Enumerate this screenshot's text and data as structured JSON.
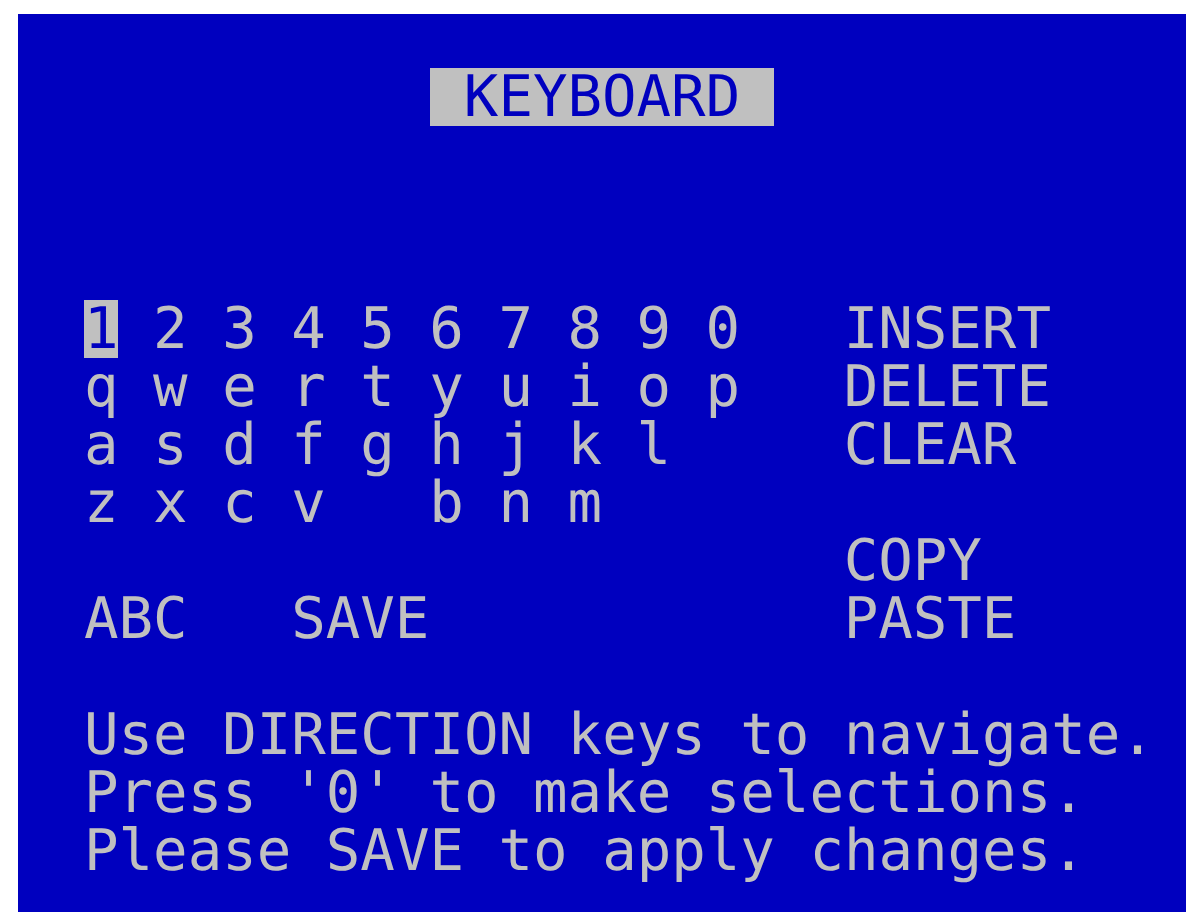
{
  "title": "KEYBOARD",
  "keys": [
    [
      {
        "label": "1",
        "selected": true
      },
      {
        "label": "2",
        "selected": false
      },
      {
        "label": "3",
        "selected": false
      },
      {
        "label": "4",
        "selected": false
      },
      {
        "label": "5",
        "selected": false
      },
      {
        "label": "6",
        "selected": false
      },
      {
        "label": "7",
        "selected": false
      },
      {
        "label": "8",
        "selected": false
      },
      {
        "label": "9",
        "selected": false
      },
      {
        "label": "0",
        "selected": false
      }
    ],
    [
      {
        "label": "q",
        "selected": false
      },
      {
        "label": "w",
        "selected": false
      },
      {
        "label": "e",
        "selected": false
      },
      {
        "label": "r",
        "selected": false
      },
      {
        "label": "t",
        "selected": false
      },
      {
        "label": "y",
        "selected": false
      },
      {
        "label": "u",
        "selected": false
      },
      {
        "label": "i",
        "selected": false
      },
      {
        "label": "o",
        "selected": false
      },
      {
        "label": "p",
        "selected": false
      }
    ],
    [
      {
        "label": "a",
        "selected": false
      },
      {
        "label": "s",
        "selected": false
      },
      {
        "label": "d",
        "selected": false
      },
      {
        "label": "f",
        "selected": false
      },
      {
        "label": "g",
        "selected": false
      },
      {
        "label": "h",
        "selected": false
      },
      {
        "label": "j",
        "selected": false
      },
      {
        "label": "k",
        "selected": false
      },
      {
        "label": "l",
        "selected": false
      }
    ],
    [
      {
        "label": "z",
        "selected": false
      },
      {
        "label": "x",
        "selected": false
      },
      {
        "label": "c",
        "selected": false
      },
      {
        "label": "v",
        "selected": false
      },
      {
        "label": "b",
        "selected": false
      },
      {
        "label": "n",
        "selected": false
      },
      {
        "label": "m",
        "selected": false
      }
    ]
  ],
  "side_actions": [
    {
      "label": "INSERT",
      "selected": false
    },
    {
      "label": "DELETE",
      "selected": false
    },
    {
      "label": "CLEAR",
      "selected": false
    },
    {
      "label": "COPY",
      "selected": false
    },
    {
      "label": "PASTE",
      "selected": false
    }
  ],
  "bottom_actions": [
    {
      "label": "ABC",
      "selected": false
    },
    {
      "label": "SAVE",
      "selected": false
    }
  ],
  "help": [
    "Use DIRECTION keys to navigate.",
    "Press '0' to make selections.",
    "Please SAVE to apply changes."
  ]
}
